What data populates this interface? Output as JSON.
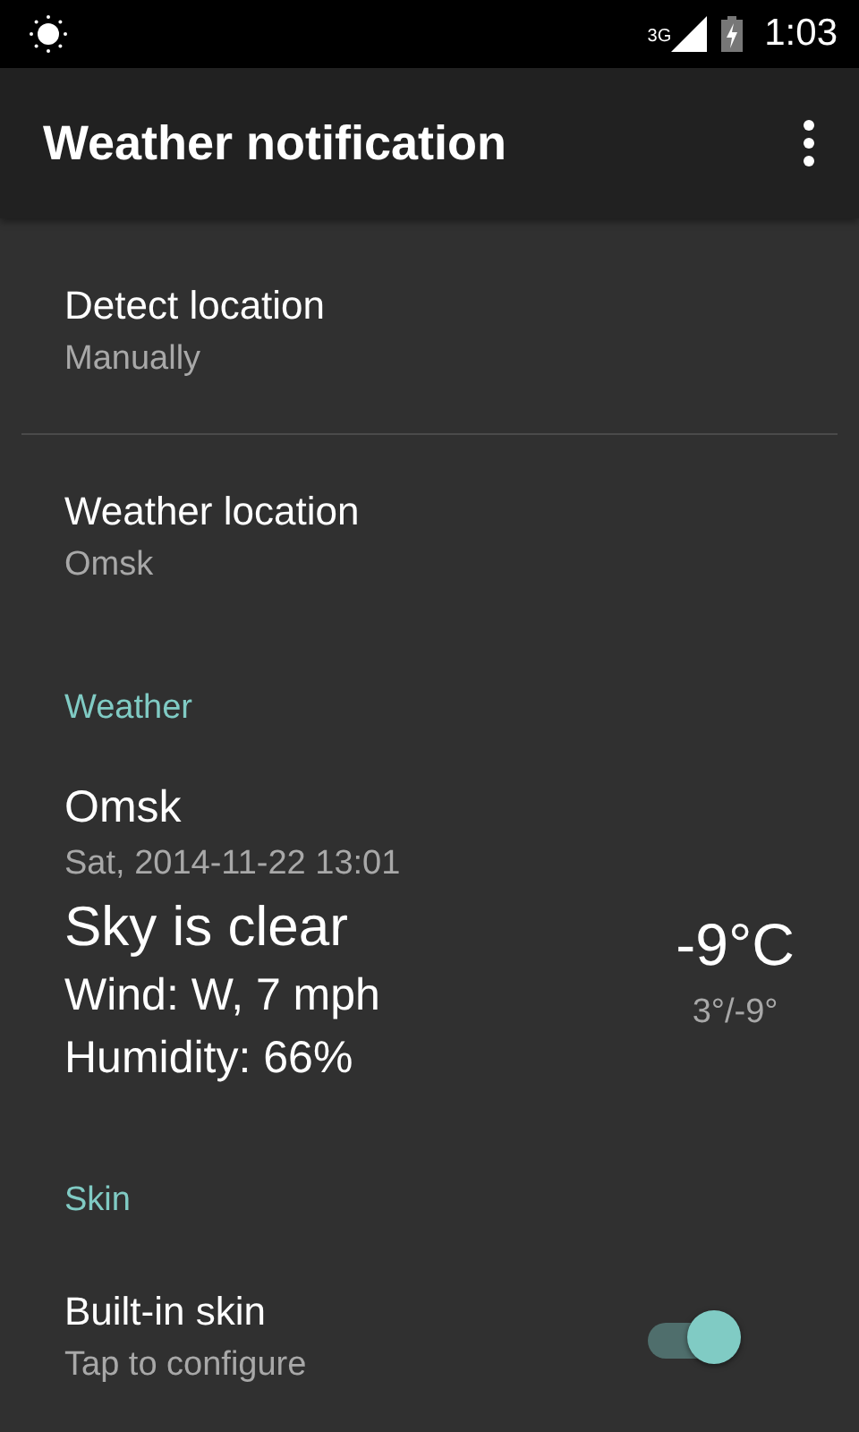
{
  "status_bar": {
    "network": "3G",
    "time": "1:03"
  },
  "toolbar": {
    "title": "Weather notification"
  },
  "location_prefs": [
    {
      "title": "Detect location",
      "summary": "Manually"
    },
    {
      "title": "Weather location",
      "summary": "Omsk"
    }
  ],
  "weather_section": {
    "header": "Weather",
    "city": "Omsk",
    "updated": "Sat, 2014-11-22 13:01",
    "condition": "Sky is clear",
    "wind": "Wind: W, 7 mph",
    "humidity": "Humidity: 66%",
    "temperature": "-9°C",
    "high_low": "3°/-9°"
  },
  "skin_section": {
    "header": "Skin",
    "title": "Built-in skin",
    "summary": "Tap to configure",
    "on": true
  }
}
